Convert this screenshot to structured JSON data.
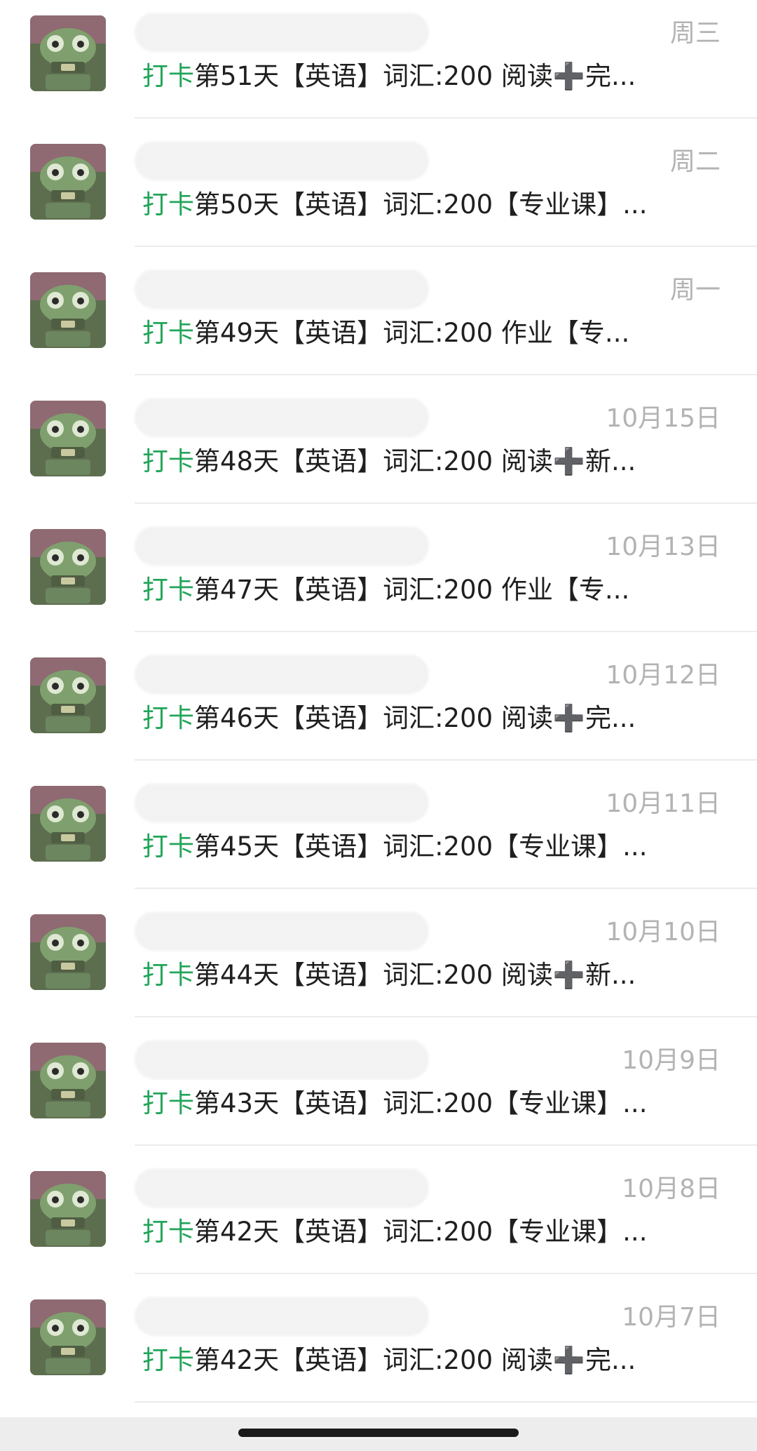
{
  "colors": {
    "tag": "#22a55a",
    "time": "#b3b3b3",
    "text": "#1f1f1f"
  },
  "chats": [
    {
      "time": "周三",
      "tag": "打卡",
      "text": "第51天【英语】词汇:200 阅读➕完..."
    },
    {
      "time": "周二",
      "tag": "打卡",
      "text": "第50天【英语】词汇:200【专业课】..."
    },
    {
      "time": "周一",
      "tag": "打卡",
      "text": "第49天【英语】词汇:200 作业【专..."
    },
    {
      "time": "10月15日",
      "tag": "打卡",
      "text": "第48天【英语】词汇:200 阅读➕新..."
    },
    {
      "time": "10月13日",
      "tag": "打卡",
      "text": "第47天【英语】词汇:200 作业【专..."
    },
    {
      "time": "10月12日",
      "tag": "打卡",
      "text": "第46天【英语】词汇:200 阅读➕完..."
    },
    {
      "time": "10月11日",
      "tag": "打卡",
      "text": "第45天【英语】词汇:200【专业课】..."
    },
    {
      "time": "10月10日",
      "tag": "打卡",
      "text": "第44天【英语】词汇:200 阅读➕新..."
    },
    {
      "time": "10月9日",
      "tag": "打卡",
      "text": "第43天【英语】词汇:200【专业课】..."
    },
    {
      "time": "10月8日",
      "tag": "打卡",
      "text": "第42天【英语】词汇:200【专业课】..."
    },
    {
      "time": "10月7日",
      "tag": "打卡",
      "text": "第42天【英语】词汇:200 阅读➕完..."
    }
  ]
}
